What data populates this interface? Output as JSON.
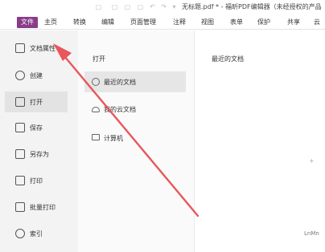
{
  "titlebar": {
    "title": "无标题.pdf * - 福昕PDF编辑器（未经授权的产品"
  },
  "ribbon": {
    "tabs": [
      {
        "label": "文件"
      },
      {
        "label": "主页"
      },
      {
        "label": "转换"
      },
      {
        "label": "编辑"
      },
      {
        "label": "页面管理"
      },
      {
        "label": "注释"
      },
      {
        "label": "视图"
      },
      {
        "label": "表单"
      },
      {
        "label": "保护"
      },
      {
        "label": "共享"
      },
      {
        "label": "云"
      }
    ]
  },
  "leftnav": {
    "items": [
      {
        "label": "文档属性",
        "icon": "document-properties-icon"
      },
      {
        "label": "创建",
        "icon": "create-icon"
      },
      {
        "label": "打开",
        "icon": "open-folder-icon"
      },
      {
        "label": "保存",
        "icon": "save-icon"
      },
      {
        "label": "另存为",
        "icon": "save-as-icon"
      },
      {
        "label": "打印",
        "icon": "print-icon"
      },
      {
        "label": "批量打印",
        "icon": "batch-print-icon"
      },
      {
        "label": "索引",
        "icon": "index-icon"
      }
    ]
  },
  "open_panel": {
    "title": "打开",
    "items": [
      {
        "label": "最近的文档",
        "icon": "clock-icon"
      },
      {
        "label": "我的云文档",
        "icon": "cloud-icon"
      },
      {
        "label": "计算机",
        "icon": "computer-icon"
      }
    ]
  },
  "recent_panel": {
    "title": "最近的文档"
  },
  "decor": {
    "watermark": "LnMn",
    "dot": "+"
  },
  "colors": {
    "accent": "#8a3c89",
    "annotation_arrow": "#e8575c"
  }
}
